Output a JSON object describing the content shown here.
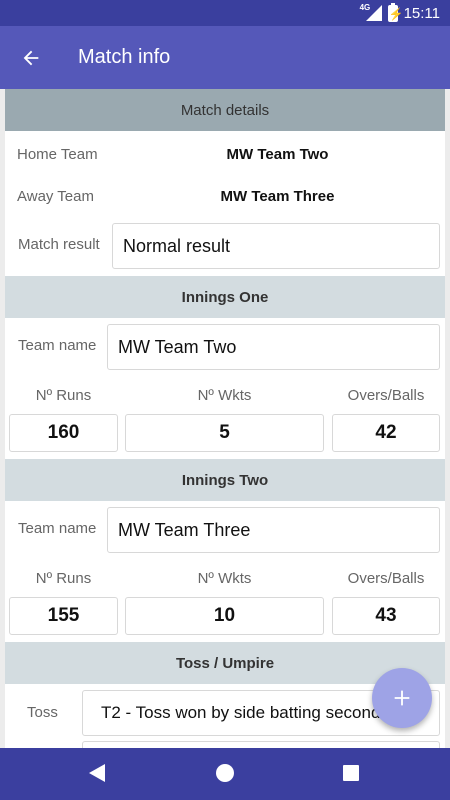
{
  "status_bar": {
    "network": "4G",
    "time": "15:11"
  },
  "app_bar": {
    "title": "Match info"
  },
  "match_details": {
    "header": "Match details",
    "home_team_label": "Home Team",
    "home_team_value": "MW Team Two",
    "away_team_label": "Away Team",
    "away_team_value": "MW Team Three",
    "result_label": "Match result",
    "result_value": "Normal result"
  },
  "innings_one": {
    "header": "Innings One",
    "team_label": "Team name",
    "team_value": "MW Team Two",
    "runs_label": "Nº Runs",
    "wkts_label": "Nº Wkts",
    "overs_label": "Overs/Balls",
    "runs": "160",
    "wkts": "5",
    "overs": "42"
  },
  "innings_two": {
    "header": "Innings Two",
    "team_label": "Team name",
    "team_value": "MW Team Three",
    "runs_label": "Nº Runs",
    "wkts_label": "Nº Wkts",
    "overs_label": "Overs/Balls",
    "runs": "155",
    "wkts": "10",
    "overs": "43"
  },
  "toss_umpire": {
    "header": "Toss / Umpire",
    "toss_label": "Toss",
    "toss_value": "T2 - Toss won by side batting second"
  },
  "icons": {
    "back": "arrow-left-icon",
    "fab": "plus-icon",
    "nav_back": "triangle-back-icon",
    "nav_home": "circle-home-icon",
    "nav_recent": "square-recents-icon"
  },
  "colors": {
    "status_bar": "#3a3f9e",
    "app_bar": "#5558b9",
    "main_header": "#9aa9b0",
    "section_header": "#d3dce0",
    "fab": "#9ea3e6",
    "nav_bar": "#3b3f9f"
  }
}
